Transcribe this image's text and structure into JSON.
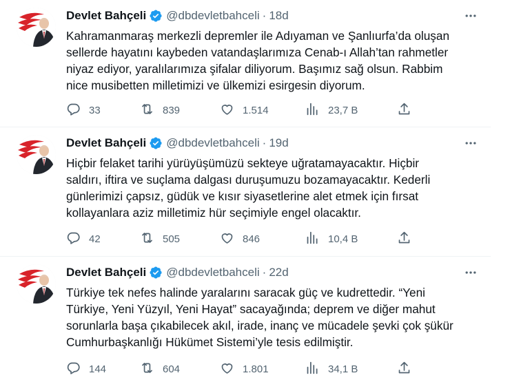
{
  "colors": {
    "accent": "#1d9bf0",
    "text": "#0f1419",
    "muted": "#536471",
    "divider": "#eff3f4"
  },
  "icons": [
    "avatar-emblem",
    "verified-badge-icon",
    "more-icon",
    "reply-icon",
    "retweet-icon",
    "like-icon",
    "views-icon",
    "share-icon"
  ],
  "tweets": [
    {
      "name": "Devlet Bahçeli",
      "handle": "@dbdevletbahceli",
      "separator": "·",
      "time": "18d",
      "text": "Kahramanmaraş merkezli depremler ile Adıyaman ve Şanlıurfa’da oluşan\nsellerde hayatını kaybeden vatandaşlarımıza Cenab-ı Allah’tan rahmetler\nniyaz ediyor, yaralılarımıza şifalar diliyorum. Başımız sağ olsun. Rabbim\nnice musibetten milletimizi ve ülkemizi esirgesin diyorum.",
      "replies": "33",
      "retweets": "839",
      "likes": "1.514",
      "views": "23,7 B"
    },
    {
      "name": "Devlet Bahçeli",
      "handle": "@dbdevletbahceli",
      "separator": "·",
      "time": "19d",
      "text": "Hiçbir felaket tarihi yürüyüşümüzü sekteye uğratamayacaktır. Hiçbir\nsaldırı, iftira ve suçlama dalgası duruşumuzu bozamayacaktır. Kederli\ngünlerimizi çapsız, güdük ve kısır siyasetlerine alet etmek için fırsat\nkollayanlara aziz milletimiz hür seçimiyle engel olacaktır.",
      "replies": "42",
      "retweets": "505",
      "likes": "846",
      "views": "10,4 B"
    },
    {
      "name": "Devlet Bahçeli",
      "handle": "@dbdevletbahceli",
      "separator": "·",
      "time": "22d",
      "text": "Türkiye tek nefes halinde yaralarını saracak güç ve kudrettedir. “Yeni\nTürkiye, Yeni Yüzyıl, Yeni Hayat” sacayağında; deprem ve diğer mahut\nsorunlarla başa çıkabilecek akıl, irade, inanç ve mücadele şevki çok şükür\nCumhurbaşkanlığı Hükümet Sistemi’yle tesis edilmiştir.",
      "replies": "144",
      "retweets": "604",
      "likes": "1.801",
      "views": "34,1 B"
    }
  ]
}
